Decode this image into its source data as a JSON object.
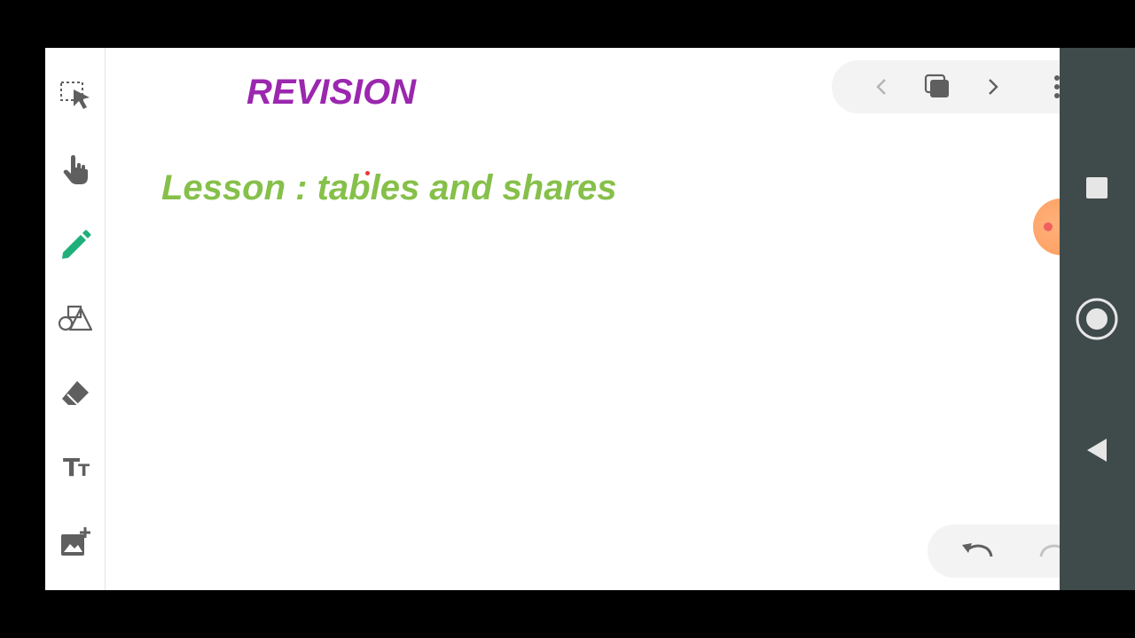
{
  "canvas": {
    "revision_title": "REVISION",
    "lesson_title": "Lesson : tables and shares"
  },
  "colors": {
    "revision": "#9b27af",
    "lesson": "#86c04a",
    "pen_tool": "#1fb07a",
    "icon_gray": "#5f5f5f",
    "ink_dot": "#e53935",
    "record_bubble": "#ffb07a",
    "record_dot": "#f06060",
    "nav_bar": "#3f4a4a"
  },
  "toolbar": {
    "tools": [
      {
        "name": "select",
        "icon": "select-icon"
      },
      {
        "name": "hand",
        "icon": "hand-icon"
      },
      {
        "name": "pen",
        "icon": "pen-icon",
        "active": true
      },
      {
        "name": "shapes",
        "icon": "shapes-icon"
      },
      {
        "name": "eraser",
        "icon": "eraser-icon"
      },
      {
        "name": "text",
        "icon": "text-icon",
        "glyph_big": "T",
        "glyph_small": "T"
      },
      {
        "name": "insert-image",
        "icon": "add-image-icon"
      }
    ]
  },
  "page_nav": {
    "icons": [
      "chevron-left-icon",
      "pages-icon",
      "chevron-right-icon",
      "more-vertical-icon"
    ]
  },
  "history": {
    "icons": [
      "undo-icon",
      "redo-icon"
    ]
  },
  "system_nav": {
    "icons": [
      "recents-square-icon",
      "home-circle-icon",
      "back-triangle-icon"
    ]
  }
}
